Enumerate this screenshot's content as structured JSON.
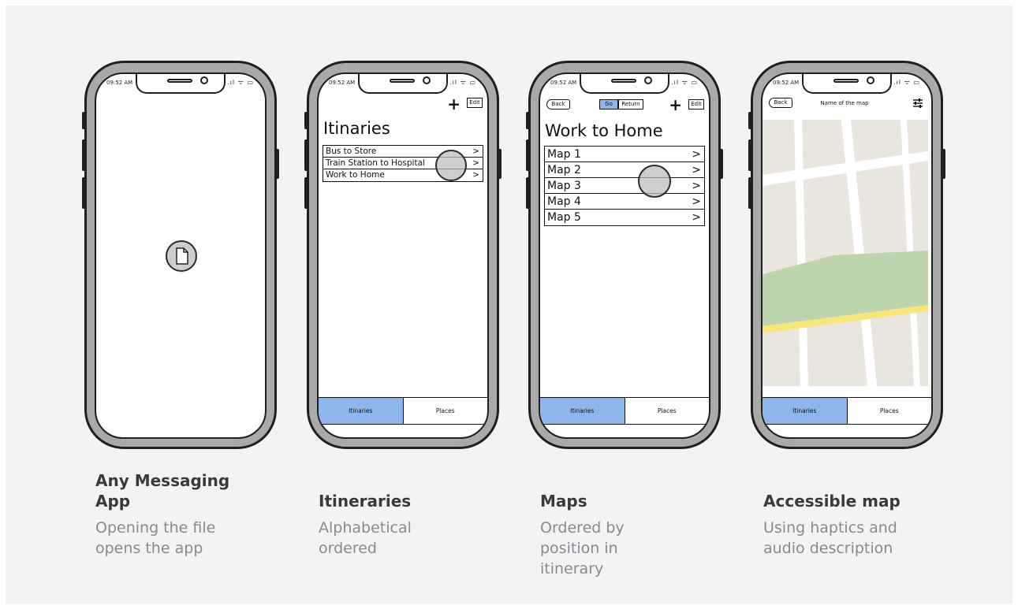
{
  "status_bar": {
    "time": "09:52 AM",
    "icons": ".ıl ᯤ ▭"
  },
  "phones": [
    {
      "caption_title": "Any Messaging App",
      "caption_desc": "Opening the file opens the app"
    },
    {
      "header_edit": "Edit",
      "title": "Itinaries",
      "list": [
        "Bus to Store",
        "Train Station to Hospital",
        "Work to Home"
      ],
      "tabs": [
        "Itinaries",
        "Places"
      ],
      "caption_title": "Itineraries",
      "caption_desc": "Alphabetical ordered"
    },
    {
      "back": "Back",
      "go": "Go",
      "return": "Return",
      "header_edit": "Edit",
      "title": "Work to Home",
      "list": [
        "Map 1",
        "Map 2",
        "Map 3",
        "Map 4",
        "Map 5"
      ],
      "tabs": [
        "Itinaries",
        "Places"
      ],
      "caption_title": "Maps",
      "caption_desc": "Ordered by position in itinerary"
    },
    {
      "back": "Back",
      "title": "Name of the map",
      "tabs": [
        "Itinaries",
        "Places"
      ],
      "caption_title": "Accessible map",
      "caption_desc": "Using haptics and audio description"
    }
  ],
  "colors": {
    "active_tab": "#8fb6ea",
    "map_park": "#bed4ae",
    "map_road": "#f7e77a",
    "map_bg": "#e9e6df"
  },
  "icons": {
    "file": "file-icon",
    "chevron": "chevron-right-icon",
    "plus": "plus-icon",
    "filter": "sliders-icon"
  }
}
